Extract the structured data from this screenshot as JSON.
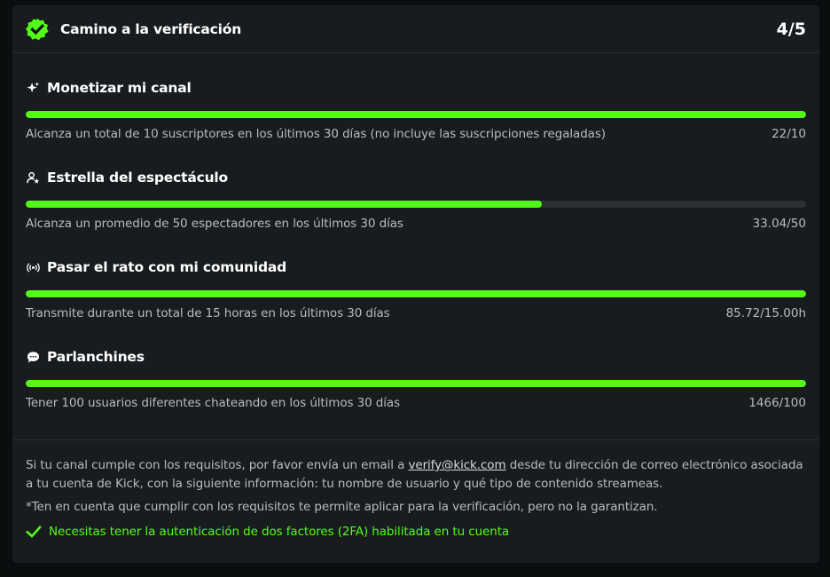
{
  "header": {
    "title": "Camino a la verificación",
    "progress": "4/5",
    "badge_icon": "verified-badge-icon",
    "accent_color": "#53fc18"
  },
  "requirements": [
    {
      "icon": "sparkles-icon",
      "title": "Monetizar mi canal",
      "description": "Alcanza un total de 10 suscriptores en los últimos 30 días (no incluye las suscripciones regaladas)",
      "value": "22/10",
      "progress_fraction": 1.0
    },
    {
      "icon": "user-star-icon",
      "title": "Estrella del espectáculo",
      "description": "Alcanza un promedio de 50 espectadores en los últimos 30 días",
      "value": "33.04/50",
      "progress_fraction": 0.6608
    },
    {
      "icon": "broadcast-icon",
      "title": "Pasar el rato con mi comunidad",
      "description": "Transmite durante un total de 15 horas en los últimos 30 días",
      "value": "85.72/15.00h",
      "progress_fraction": 1.0
    },
    {
      "icon": "chat-bubble-icon",
      "title": "Parlanchines",
      "description": "Tener 100 usuarios diferentes chateando en los últimos 30 días",
      "value": "1466/100",
      "progress_fraction": 1.0
    }
  ],
  "footer": {
    "info_before": "Si tu canal cumple con los requisitos, por favor envía un email a ",
    "email": "verify@kick.com",
    "info_after": " desde tu dirección de correo electrónico asociada a tu cuenta de Kick, con la siguiente información: tu nombre de usuario y qué tipo de contenido streameas.",
    "note": "*Ten en cuenta que cumplir con los requisitos te permite aplicar para la verificación, pero no la garantizan.",
    "twofa": "Necesitas tener la autenticación de dos factores (2FA) habilitada en tu cuenta",
    "twofa_icon": "checkmark-icon"
  }
}
